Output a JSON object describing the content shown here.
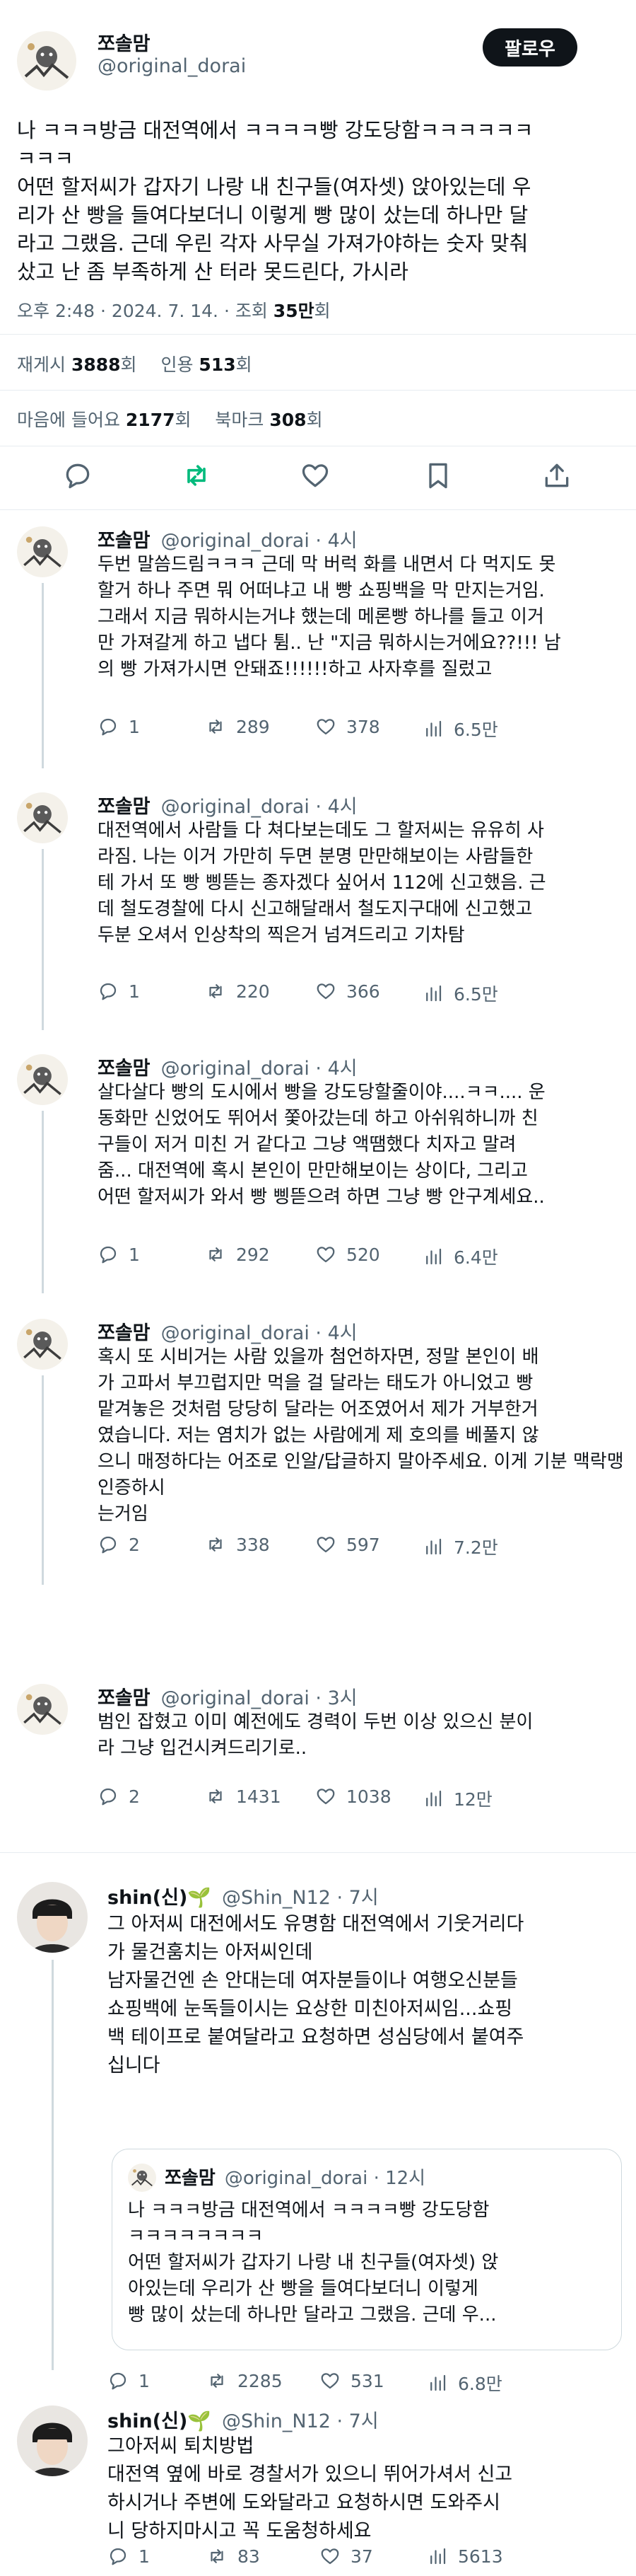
{
  "main": {
    "name": "쪼솔맘",
    "handle": "@original_dorai",
    "follow_label": "팔로우",
    "text": "나 ㅋㅋㅋ방금 대전역에서 ㅋㅋㅋㅋ빵 강도당함ㅋㅋㅋㅋㅋㅋ\nㅋㅋㅋ\n어떤 할저씨가 갑자기 나랑 내 친구들(여자셋) 앉아있는데 우\n리가 산 빵을 들여다보더니 이렇게 빵 많이 샀는데 하나만 달\n라고 그랬음. 근데 우린 각자 사무실 가져가야하는 숫자 맞춰\n샀고 난 좀 부족하게 산 터라 못드린다, 가시라",
    "time_prefix": "오후 2:48 · 2024. 7. 14. · 조회 ",
    "views": "35만",
    "views_suffix": "회",
    "reposts_label": "재게시 ",
    "reposts": "3888",
    "reposts_suffix": "회",
    "quotes_label": "인용 ",
    "quotes": "513",
    "quotes_suffix": "회",
    "likes_label": "마음에 들어요 ",
    "likes": "2177",
    "likes_suffix": "회",
    "bookmarks_label": "북마크 ",
    "bookmarks": "308",
    "bookmarks_suffix": "회"
  },
  "replies": [
    {
      "name": "쪼솔맘",
      "handle": "@original_dorai · 4시",
      "text": "두번 말씀드림ㅋㅋㅋ 근데 막 버럭 화를 내면서 다 먹지도 못\n할거 하나 주면 뭐 어떠냐고 내 빵 쇼핑백을 막 만지는거임.\n그래서 지금 뭐하시는거냐 했는데 메론빵 하나를 들고 이거\n만 가져갈게 하고 냅다 튐.. 난 \"지금 뭐하시는거에요??!!! 남\n의 빵 가져가시면 안돼죠!!!!!!하고 사자후를 질렀고",
      "reply": "1",
      "repost": "289",
      "like": "378",
      "views": "6.5만"
    },
    {
      "name": "쪼솔맘",
      "handle": "@original_dorai · 4시",
      "text": "대전역에서 사람들 다 쳐다보는데도 그 할저씨는 유유히 사\n라짐. 나는 이거 가만히 두면 분명 만만해보이는 사람들한\n테 가서 또 빵 삥뜯는 종자겠다 싶어서 112에 신고했음. 근\n데 철도경찰에 다시 신고해달래서 철도지구대에 신고했고\n두분 오셔서 인상착의 찍은거 넘겨드리고 기차탐",
      "reply": "1",
      "repost": "220",
      "like": "366",
      "views": "6.5만"
    },
    {
      "name": "쪼솔맘",
      "handle": "@original_dorai · 4시",
      "text": "살다살다 빵의 도시에서 빵을 강도당할줄이야....ㅋㅋ.... 운\n동화만 신었어도 뛰어서 쫓아갔는데 하고 아쉬워하니까 친\n구들이 저거 미친 거 같다고 그냥 액땜했다 치자고 말려\n줌... 대전역에 혹시 본인이 만만해보이는 상이다, 그리고\n어떤 할저씨가 와서 빵 삥뜯으려 하면 그냥 빵 안구계세요..",
      "reply": "1",
      "repost": "292",
      "like": "520",
      "views": "6.4만"
    },
    {
      "name": "쪼솔맘",
      "handle": "@original_dorai · 4시",
      "text": "혹시 또 시비거는 사람 있을까 첨언하자면, 정말 본인이 배\n가 고파서 부끄럽지만 먹을 걸 달라는 태도가 아니었고 빵\n맡겨놓은 것처럼 당당히 달라는 어조였어서 제가 거부한거\n였습니다. 저는 염치가 없는 사람에게 제 호의를 베풀지 않\n으니 매정하다는 어조로 인알/답글하지 말아주세요. 이게 기분 맥락맹인증하시\n는거임",
      "reply": "2",
      "repost": "338",
      "like": "597",
      "views": "7.2만"
    },
    {
      "name": "쪼솔맘",
      "handle": "@original_dorai · 3시",
      "text": "범인 잡혔고 이미 예전에도 경력이 두번 이상 있으신 분이\n라 그냥 입건시켜드리기로..",
      "reply": "2",
      "repost": "1431",
      "like": "1038",
      "views": "12만"
    }
  ],
  "shin1": {
    "name": "shin(신)",
    "sprout": "🌱",
    "handle": "@Shin_N12 · 7시",
    "text": "그 아저씨 대전에서도 유명함 대전역에서 기웃거리다\n가 물건훔치는 아저씨인데\n남자물건엔 손 안대는데 여자분들이나 여행오신분들\n쇼핑백에 눈독들이시는 요상한 미친아저씨임...쇼핑\n백 테이프로 붙여달라고 요청하면 성심당에서 붙여주\n십니다",
    "quote_name": "쪼솔맘",
    "quote_handle": "@original_dorai · 12시",
    "quote_text": "나 ㅋㅋㅋ방금 대전역에서 ㅋㅋㅋㅋ빵 강도당함\nㅋㅋㅋㅋㅋㅋㅋㅋ\n어떤 할저씨가 갑자기 나랑 내 친구들(여자셋) 앉\n아있는데 우리가 산 빵을 들여다보더니 이렇게\n빵 많이 샀는데 하나만 달라고 그랬음. 근데 우...",
    "reply": "1",
    "repost": "2285",
    "like": "531",
    "views": "6.8만"
  },
  "shin2": {
    "name": "shin(신)",
    "sprout": "🌱",
    "handle": "@Shin_N12 · 7시",
    "text": "그아저씨 퇴치방법\n대전역 옆에 바로 경찰서가 있으니 뛰어가셔서 신고\n하시거나 주변에 도와달라고 요청하시면 도와주시\n니 당하지마시고 꼭 도움청하세요",
    "reply": "1",
    "repost": "83",
    "like": "37",
    "views": "5613"
  }
}
